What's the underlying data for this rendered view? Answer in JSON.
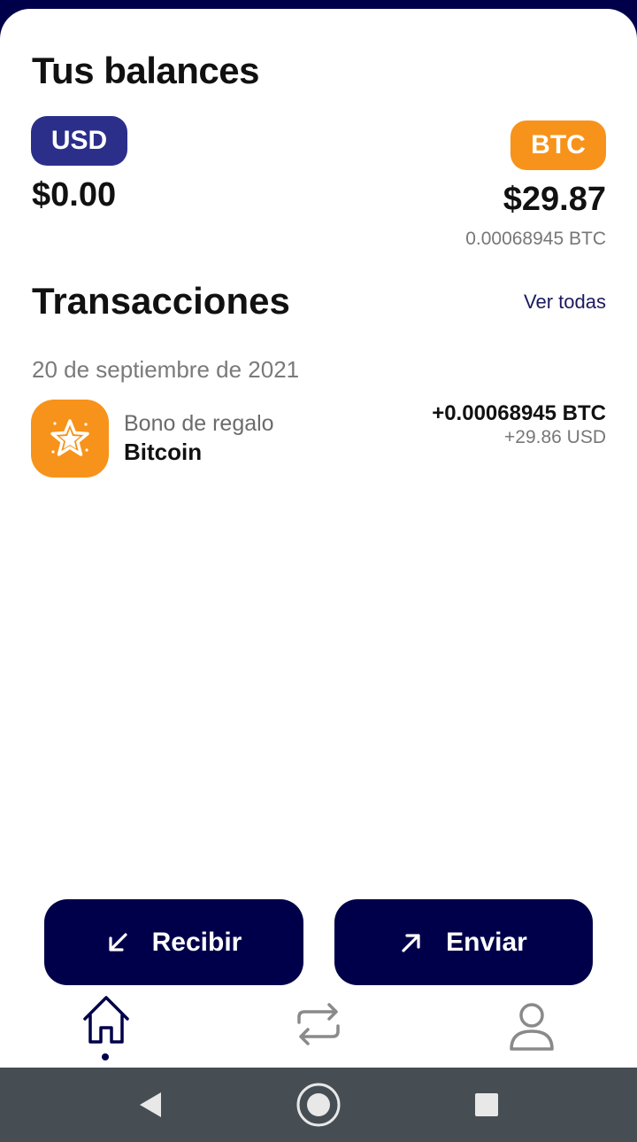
{
  "balances": {
    "title": "Tus balances",
    "usd": {
      "label": "USD",
      "amount": "$0.00"
    },
    "btc": {
      "label": "BTC",
      "amount": "$29.87",
      "sub": "0.00068945 BTC"
    }
  },
  "transactions": {
    "title": "Transacciones",
    "see_all": "Ver todas",
    "groups": [
      {
        "date": "20 de septiembre de 2021",
        "items": [
          {
            "name": "Bono de regalo",
            "asset": "Bitcoin",
            "amount": "+0.00068945 BTC",
            "fiat": "+29.86 USD",
            "icon": "star-icon"
          }
        ]
      }
    ]
  },
  "actions": {
    "receive": "Recibir",
    "send": "Enviar"
  },
  "tabs": [
    {
      "name": "home",
      "icon": "home-icon",
      "active": true
    },
    {
      "name": "transfer",
      "icon": "swap-icon",
      "active": false
    },
    {
      "name": "profile",
      "icon": "user-icon",
      "active": false
    }
  ],
  "colors": {
    "navy": "#00004a",
    "usd_pill": "#2b2f8a",
    "btc_orange": "#f7931a",
    "system_nav": "#464e54"
  }
}
